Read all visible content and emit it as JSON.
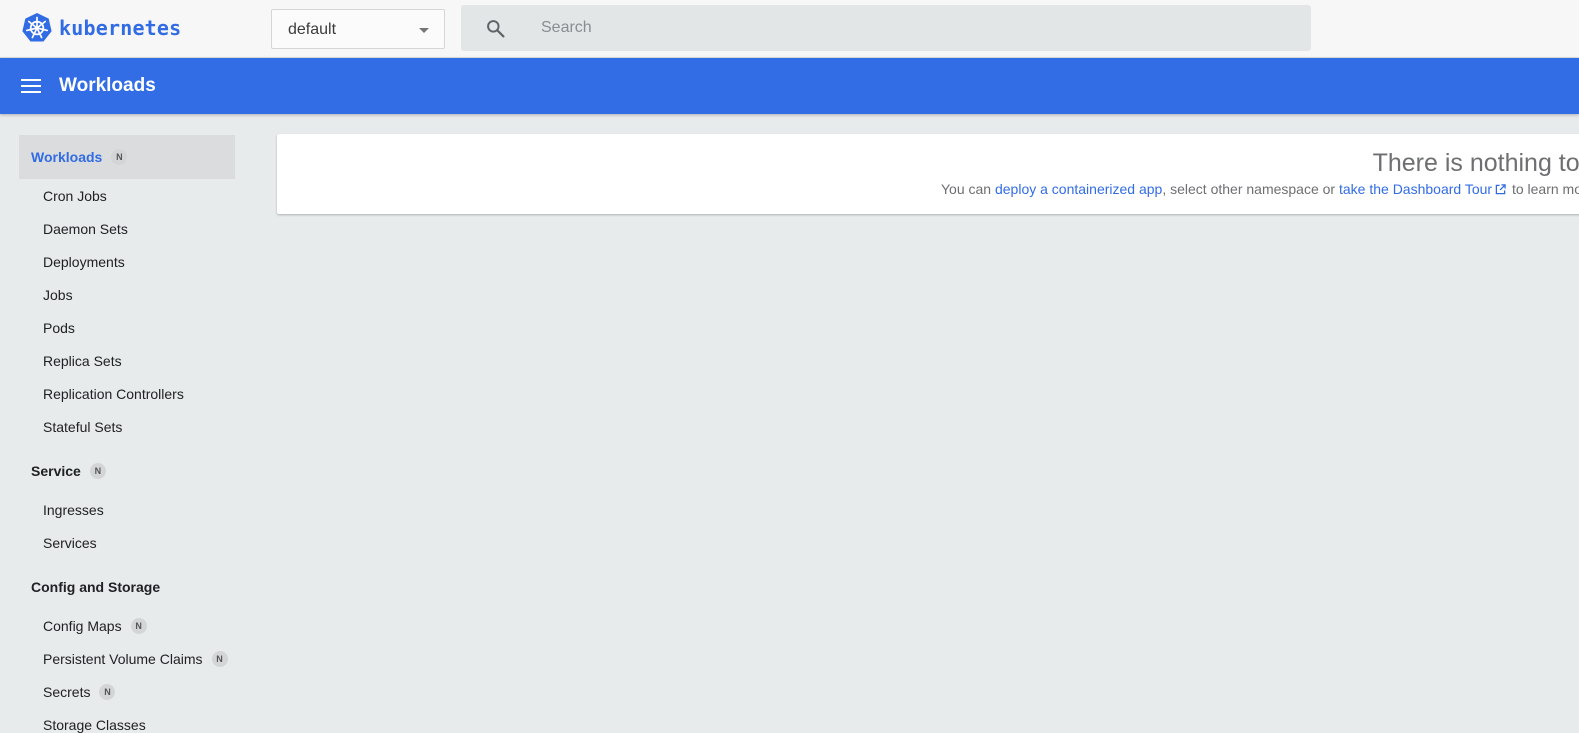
{
  "brand": {
    "name": "kubernetes",
    "logo_icon": "kubernetes-helm-icon",
    "accent": "#326ce5"
  },
  "namespace": {
    "selected": "default"
  },
  "search": {
    "placeholder": "Search"
  },
  "toolbar": {
    "title": "Workloads",
    "background": "#326de6"
  },
  "sidebar": {
    "badge": "N",
    "groups": [
      {
        "label": "Workloads",
        "badge": "N",
        "active": true,
        "items": [
          {
            "label": "Cron Jobs"
          },
          {
            "label": "Daemon Sets"
          },
          {
            "label": "Deployments"
          },
          {
            "label": "Jobs"
          },
          {
            "label": "Pods"
          },
          {
            "label": "Replica Sets"
          },
          {
            "label": "Replication Controllers"
          },
          {
            "label": "Stateful Sets"
          }
        ]
      },
      {
        "label": "Service",
        "badge": "N",
        "items": [
          {
            "label": "Ingresses"
          },
          {
            "label": "Services"
          }
        ]
      },
      {
        "label": "Config and Storage",
        "items": [
          {
            "label": "Config Maps",
            "badge": "N"
          },
          {
            "label": "Persistent Volume Claims",
            "badge": "N"
          },
          {
            "label": "Secrets",
            "badge": "N"
          },
          {
            "label": "Storage Classes"
          }
        ]
      }
    ]
  },
  "empty_state": {
    "title": "There is nothing to display here",
    "text_prefix": "You can ",
    "link_deploy": "deploy a containerized app",
    "text_middle": ", select other namespace or ",
    "link_tour": "take the Dashboard Tour",
    "text_suffix": " to learn mo"
  }
}
